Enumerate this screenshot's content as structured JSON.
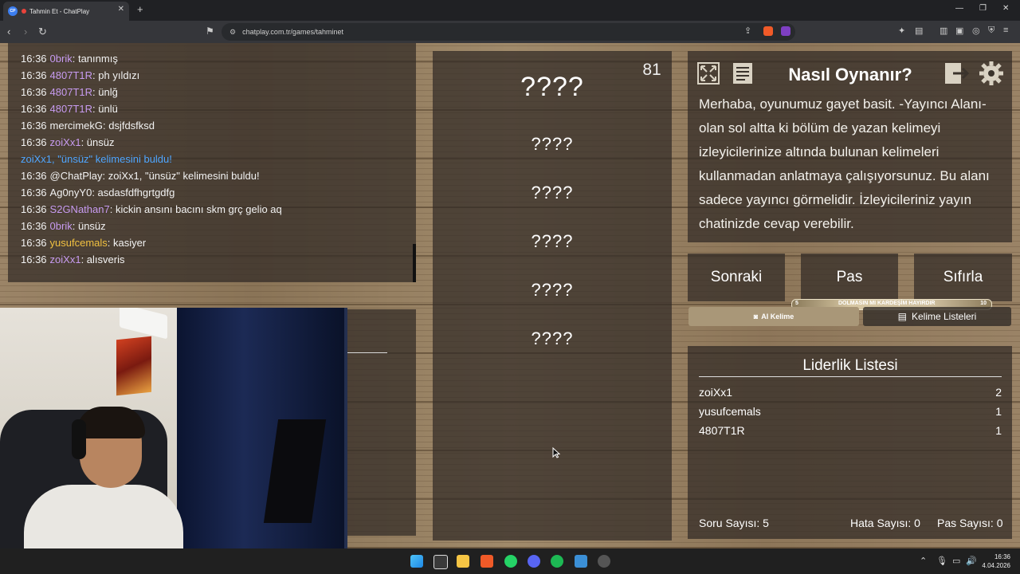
{
  "browser": {
    "tab_title": "Tahmin Et - ChatPlay",
    "favicon_text": "CP",
    "url": "chatplay.com.tr/games/tahminet"
  },
  "chat": {
    "lines": [
      {
        "time": "16:36",
        "user": "0brik",
        "user_color": "#c79bf0",
        "text": ": tanınmış"
      },
      {
        "time": "16:36",
        "user": "4807T1R",
        "user_color": "#c79bf0",
        "text": ": ph yıldızı"
      },
      {
        "time": "16:36",
        "user": "4807T1R",
        "user_color": "#c79bf0",
        "text": ": ünlğ"
      },
      {
        "time": "16:36",
        "user": "4807T1R",
        "user_color": "#c79bf0",
        "text": ": ünlü"
      },
      {
        "time": "16:36",
        "user": "mercimekG",
        "user_color": "#f2f2f2",
        "text": ": dsjfdsfksd"
      },
      {
        "time": "16:36",
        "user": "zoiXx1",
        "user_color": "#c79bf0",
        "text": ": ünsüz"
      },
      {
        "time": "",
        "user": "zoiXx1, \"ünsüz\" kelimesini buldu!",
        "user_color": "#4fa6ff",
        "text": ""
      },
      {
        "time": "16:36",
        "user": "@ChatPlay",
        "user_color": "#f2f2f2",
        "text": ": zoiXx1, \"ünsüz\" kelimesini buldu!"
      },
      {
        "time": "16:36",
        "user": "Ag0nyY0",
        "user_color": "#f2f2f2",
        "text": ": asdasfdfhgrtgdfg"
      },
      {
        "time": "16:36",
        "user": "S2GNathan7",
        "user_color": "#c79bf0",
        "text": ": kickin ansını bacını skm grç gelio aq"
      },
      {
        "time": "16:36",
        "user": "0brik",
        "user_color": "#c79bf0",
        "text": ": ünsüz"
      },
      {
        "time": "16:36",
        "user": "yusufcemals",
        "user_color": "#f0c040",
        "text": ": kasiyer"
      },
      {
        "time": "16:36",
        "user": "zoiXx1",
        "user_color": "#c79bf0",
        "text": ": alısveris"
      }
    ]
  },
  "game": {
    "counter": "81",
    "words": [
      "????",
      "????",
      "????",
      "????",
      "????",
      "????"
    ]
  },
  "howto": {
    "title": "Nasıl Oynanır?",
    "text": "Merhaba, oyunumuz gayet basit. -Yayıncı Alanı- olan sol altta ki bölüm de yazan kelimeyi izleyicilerinize altında bulunan kelimeleri kullanmadan anlatmaya çalışıyorsunuz. Bu alanı sadece yayıncı görmelidir. İzleyicileriniz yayın chatinizde cevap verebilir."
  },
  "controls": {
    "next": "Sonraki",
    "pass": "Pas",
    "reset": "Sıfırla",
    "progress_text": "DOLMASIN MI KARDEŞİM HAYIRDIR",
    "progress_min": "5",
    "progress_max": "10",
    "ai_word": "AI Kelime",
    "word_lists": "Kelime Listeleri"
  },
  "leaderboard": {
    "title": "Liderlik Listesi",
    "rows": [
      {
        "name": "zoiXx1",
        "score": "2"
      },
      {
        "name": "yusufcemals",
        "score": "1"
      },
      {
        "name": "4807T1R",
        "score": "1"
      }
    ],
    "questions_label": "Soru Sayısı: 5",
    "errors_label": "Hata Sayısı: 0",
    "passes_label": "Pas Sayısı: 0"
  },
  "taskbar": {
    "time": "16:36",
    "date": "4.04.2026"
  },
  "icons": {
    "fullscreen": "fullscreen-icon",
    "notes": "document-icon",
    "logout": "logout-icon",
    "settings": "gear-icon"
  }
}
